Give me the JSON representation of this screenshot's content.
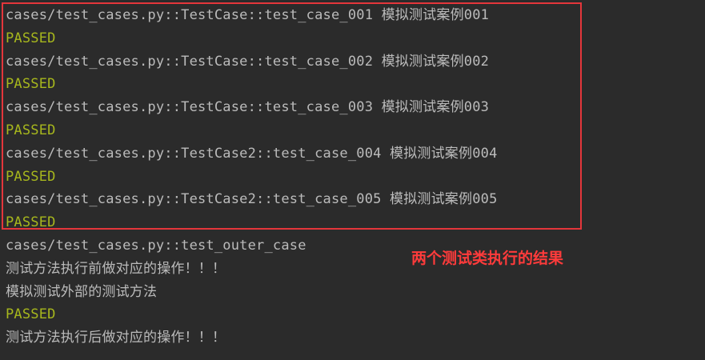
{
  "console": {
    "lines": [
      {
        "text": "cases/test_cases.py::TestCase::test_case_001 模拟测试案例001",
        "kind": "test-id"
      },
      {
        "text": "PASSED",
        "kind": "passed"
      },
      {
        "text": "cases/test_cases.py::TestCase::test_case_002 模拟测试案例002",
        "kind": "test-id"
      },
      {
        "text": "PASSED",
        "kind": "passed"
      },
      {
        "text": "cases/test_cases.py::TestCase::test_case_003 模拟测试案例003",
        "kind": "test-id"
      },
      {
        "text": "PASSED",
        "kind": "passed"
      },
      {
        "text": "cases/test_cases.py::TestCase2::test_case_004 模拟测试案例004",
        "kind": "test-id"
      },
      {
        "text": "PASSED",
        "kind": "passed"
      },
      {
        "text": "cases/test_cases.py::TestCase2::test_case_005 模拟测试案例005",
        "kind": "test-id"
      },
      {
        "text": "PASSED",
        "kind": "passed"
      },
      {
        "text": "cases/test_cases.py::test_outer_case",
        "kind": "test-id"
      },
      {
        "text": "测试方法执行前做对应的操作！！！",
        "kind": "output"
      },
      {
        "text": "模拟测试外部的测试方法",
        "kind": "output"
      },
      {
        "text": "PASSED",
        "kind": "passed"
      },
      {
        "text": "测试方法执行后做对应的操作！！！",
        "kind": "output"
      }
    ]
  },
  "annotation": {
    "text": "两个测试类执行的结果"
  },
  "colors": {
    "background": "#2b2b2b",
    "text": "#bbbbbb",
    "passed": "#a7b71d",
    "highlight": "#e4363b",
    "annotation": "#ff3b3b"
  }
}
